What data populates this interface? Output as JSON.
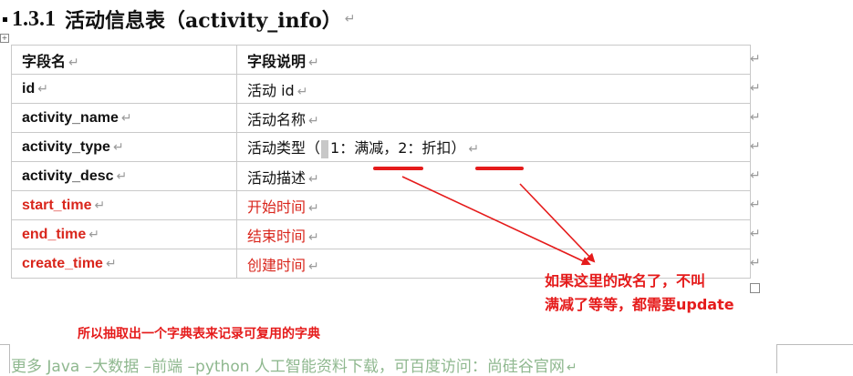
{
  "heading": {
    "number": "1.3.1",
    "title": "活动信息表（activity_info）",
    "mark": "↵"
  },
  "table": {
    "header": [
      "字段名",
      "字段说明"
    ],
    "rows": [
      {
        "field": "id",
        "desc": "活动 id"
      },
      {
        "field": "activity_name",
        "desc": "活动名称"
      },
      {
        "field": "activity_type",
        "desc_pre": "活动类型（",
        "desc_post": "1：满减，2：折扣）"
      },
      {
        "field": "activity_desc",
        "desc": "活动描述"
      },
      {
        "field": "start_time",
        "desc": "开始时间"
      },
      {
        "field": "end_time",
        "desc": "结束时间"
      },
      {
        "field": "create_time",
        "desc": "创建时间"
      }
    ],
    "cell_mark": "↵",
    "row_mark": "↵",
    "highlight_color": "#d9261c"
  },
  "annotations": {
    "note_line1": "如果这里的改名了，不叫",
    "note_line2": "满减了等等，都需要update",
    "note_bottom": "所以抽取出一个字典表来记录可复用的字典",
    "color": "#e51b1b"
  },
  "footer": {
    "text": "更多 Java –大数据 –前端 –python 人工智能资料下载，可百度访问：尚硅谷官网",
    "mark": "↵"
  },
  "icons": {
    "table_anchor": "move-anchor-icon",
    "table_resize": "resize-handle-icon"
  }
}
